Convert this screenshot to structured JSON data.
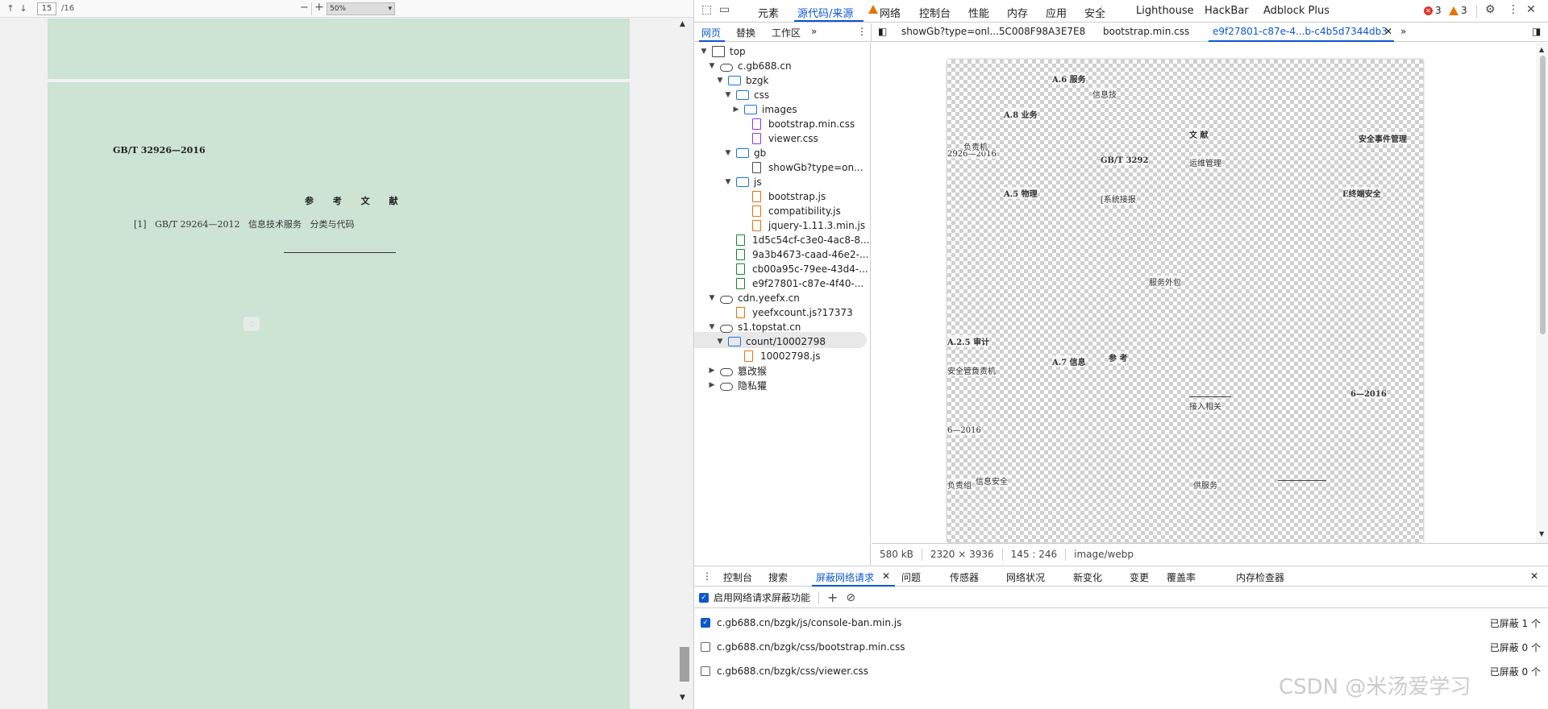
{
  "viewer": {
    "toolbar": {
      "page_value": "15",
      "page_total": "/16",
      "zoom_value": "50%"
    },
    "document": {
      "standard_code": "GB/T 32926—2016",
      "heading": "参 考 文 献",
      "reference": "[1]   GB/T 29264—2012   信息技术服务   分类与代码"
    }
  },
  "devtools": {
    "top_tabs": [
      "元素",
      "源代码/来源",
      "网络",
      "控制台",
      "性能",
      "内存",
      "应用",
      "安全",
      "Lighthouse",
      "HackBar",
      "Adblock Plus"
    ],
    "error_count": "3",
    "warning_count": "3",
    "nav_tabs": [
      "网页",
      "替换",
      "工作区"
    ],
    "file_tabs": [
      "showGb?type=onl...5C008F98A3E7E8",
      "bootstrap.min.css",
      "e9f27801-c87e-4...b-c4b5d7344db3"
    ],
    "tree": [
      {
        "label": "top",
        "icon": "frame-icon",
        "depth": 0,
        "arrow": "▼"
      },
      {
        "label": "c.gb688.cn",
        "icon": "cloud-icon",
        "depth": 1,
        "arrow": "▼"
      },
      {
        "label": "bzgk",
        "icon": "folder-icon",
        "depth": 2,
        "arrow": "▼"
      },
      {
        "label": "css",
        "icon": "folder-icon",
        "depth": 3,
        "arrow": "▼"
      },
      {
        "label": "images",
        "icon": "folder-icon",
        "depth": 4,
        "arrow": "▶"
      },
      {
        "label": "bootstrap.min.css",
        "icon": "file-purple-icon",
        "depth": 5,
        "arrow": ""
      },
      {
        "label": "viewer.css",
        "icon": "file-purple-icon",
        "depth": 5,
        "arrow": ""
      },
      {
        "label": "gb",
        "icon": "folder-icon",
        "depth": 3,
        "arrow": "▼"
      },
      {
        "label": "showGb?type=on...",
        "icon": "file-grey-icon",
        "depth": 5,
        "arrow": ""
      },
      {
        "label": "js",
        "icon": "folder-icon",
        "depth": 3,
        "arrow": "▼"
      },
      {
        "label": "bootstrap.js",
        "icon": "file-orange-icon",
        "depth": 5,
        "arrow": ""
      },
      {
        "label": "compatibility.js",
        "icon": "file-orange-icon",
        "depth": 5,
        "arrow": ""
      },
      {
        "label": "jquery-1.11.3.min.js",
        "icon": "file-orange-icon",
        "depth": 5,
        "arrow": ""
      },
      {
        "label": "1d5c54cf-c3e0-4ac8-8...",
        "icon": "file-green-icon",
        "depth": 3,
        "arrow": ""
      },
      {
        "label": "9a3b4673-caad-46e2-...",
        "icon": "file-green-icon",
        "depth": 3,
        "arrow": ""
      },
      {
        "label": "cb00a95c-79ee-43d4-...",
        "icon": "file-green-icon",
        "depth": 3,
        "arrow": ""
      },
      {
        "label": "e9f27801-c87e-4f40-...",
        "icon": "file-green-icon",
        "depth": 3,
        "arrow": ""
      },
      {
        "label": "cdn.yeefx.cn",
        "icon": "cloud-icon",
        "depth": 1,
        "arrow": "▼"
      },
      {
        "label": "yeefxcount.js?17373",
        "icon": "file-orange-icon",
        "depth": 3,
        "arrow": ""
      },
      {
        "label": "s1.topstat.cn",
        "icon": "cloud-icon",
        "depth": 1,
        "arrow": "▼"
      },
      {
        "label": "count/10002798",
        "icon": "folder-icon",
        "depth": 2,
        "arrow": "▼"
      },
      {
        "label": "10002798.js",
        "icon": "file-orange-icon",
        "depth": 4,
        "arrow": ""
      },
      {
        "label": "篡改猴",
        "icon": "cloud-icon",
        "depth": 1,
        "arrow": "▶"
      },
      {
        "label": "隐私獾",
        "icon": "cloud-icon",
        "depth": 1,
        "arrow": "▶"
      }
    ],
    "preview_fragments": [
      "A.6   服务",
      "A.8   业务",
      "GB/T 3292",
      "2926—2016",
      "A.5   物理",
      "文   献",
      "安全事件管理",
      "E终端安全",
      "A.2.5   审计",
      "A.7   信息",
      "参   考",
      "6—2016",
      "负责机",
      "[系统接报",
      "信息技",
      "运维管理",
      "接入相关",
      "安全管理",
      "6—2016",
      "供服务",
      "信息安全",
      "负责组",
      "服务外包",
      "负责机"
    ],
    "status": {
      "size": "580 kB",
      "dimensions": "2320 × 3936",
      "cursor": "145 : 246",
      "mime": "image/webp"
    },
    "drawer_tabs": [
      "控制台",
      "搜索",
      "屏蔽网络请求",
      "问题",
      "传感器",
      "网络状况",
      "新变化",
      "变更",
      "覆盖率",
      "内存检查器"
    ],
    "drawer_toolbar": {
      "enable_label": "启用网络请求屏蔽功能"
    },
    "rules": [
      {
        "pattern": "c.gb688.cn/bzgk/js/console-ban.min.js",
        "checked": true,
        "count": "已屏蔽 1 个"
      },
      {
        "pattern": "c.gb688.cn/bzgk/css/bootstrap.min.css",
        "checked": false,
        "count": "已屏蔽 0 个"
      },
      {
        "pattern": "c.gb688.cn/bzgk/css/viewer.css",
        "checked": false,
        "count": "已屏蔽 0 个"
      }
    ]
  },
  "watermark": "CSDN @米汤爱学习",
  "colors": {
    "accent": "#0b57d0",
    "page_green": "#cde3d4",
    "error": "#dc362e",
    "warning": "#e37400"
  }
}
